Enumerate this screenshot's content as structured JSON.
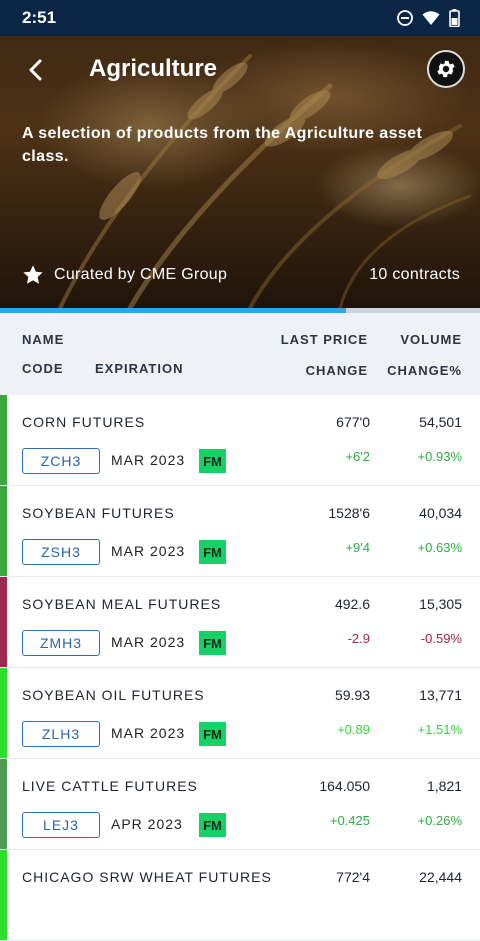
{
  "status": {
    "time": "2:51"
  },
  "header": {
    "title": "Agriculture",
    "description": "A selection of products from the Agriculture asset class.",
    "curated_by": "Curated by CME Group",
    "contracts_count": "10 contracts"
  },
  "scroll_progress": 0.72,
  "columns": {
    "name": "NAME",
    "code": "CODE",
    "expiration": "EXPIRATION",
    "last_price": "LAST PRICE",
    "volume": "VOLUME",
    "change": "CHANGE",
    "change_pct": "CHANGE%"
  },
  "colors": {
    "up": "#2eae46",
    "down": "#a2244a",
    "up_bright": "#37d43b",
    "accent": "#2aa7e6"
  },
  "rows": [
    {
      "name": "CORN FUTURES",
      "code": "ZCH3",
      "expiration": "MAR 2023",
      "badge": "FM",
      "price": "677'0",
      "volume": "54,501",
      "change": "+6'2",
      "change_pct": "+0.93%",
      "bar_color": "#3aa83a",
      "text_color": "#2eae46"
    },
    {
      "name": "SOYBEAN FUTURES",
      "code": "ZSH3",
      "expiration": "MAR 2023",
      "badge": "FM",
      "price": "1528'6",
      "volume": "40,034",
      "change": "+9'4",
      "change_pct": "+0.63%",
      "bar_color": "#3aa83a",
      "text_color": "#2eae46"
    },
    {
      "name": "SOYBEAN MEAL FUTURES",
      "code": "ZMH3",
      "expiration": "MAR 2023",
      "badge": "FM",
      "price": "492.6",
      "volume": "15,305",
      "change": "-2.9",
      "change_pct": "-0.59%",
      "bar_color": "#9c2a4e",
      "text_color": "#a2244a"
    },
    {
      "name": "SOYBEAN OIL FUTURES",
      "code": "ZLH3",
      "expiration": "MAR 2023",
      "badge": "FM",
      "price": "59.93",
      "volume": "13,771",
      "change": "+0.89",
      "change_pct": "+1.51%",
      "bar_color": "#2de02d",
      "text_color": "#37d43b"
    },
    {
      "name": "LIVE CATTLE FUTURES",
      "code": "LEJ3",
      "expiration": "APR 2023",
      "badge": "FM",
      "price": "164.050",
      "volume": "1,821",
      "change": "+0.425",
      "change_pct": "+0.26%",
      "bar_color": "#4f9a55",
      "text_color": "#2eae46"
    },
    {
      "name": "CHICAGO SRW WHEAT FUTURES",
      "code": "",
      "expiration": "",
      "badge": "",
      "price": "772'4",
      "volume": "22,444",
      "change": "",
      "change_pct": "",
      "bar_color": "#2de02d",
      "text_color": "#37d43b"
    }
  ]
}
